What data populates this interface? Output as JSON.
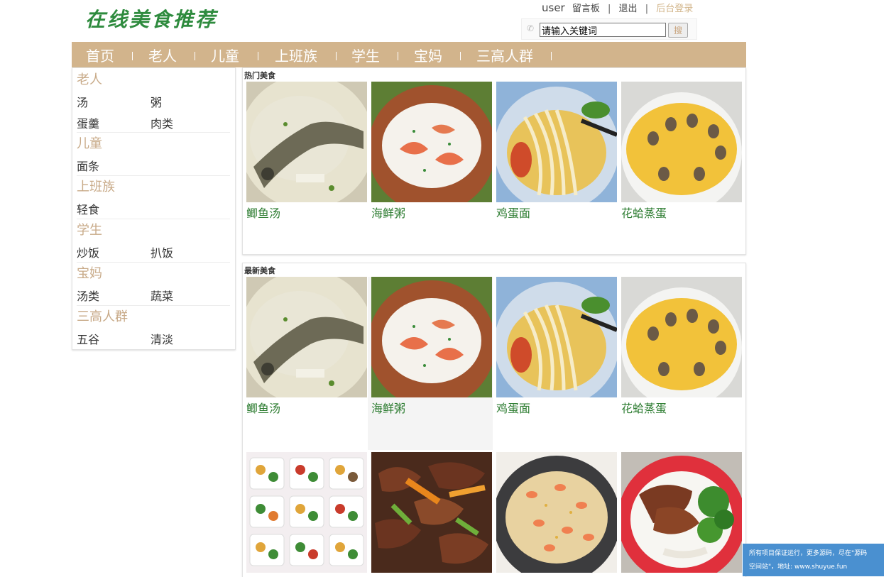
{
  "site_title": "在线美食推荐",
  "top": {
    "user": "user",
    "board": "留言板",
    "sep": "|",
    "logout": "退出",
    "admin": "后台登录"
  },
  "search": {
    "value": "请输入关键词",
    "button": "搜"
  },
  "nav": [
    "首页",
    "老人",
    "儿童",
    "上班族",
    "学生",
    "宝妈",
    "三高人群"
  ],
  "nav_sep": "|",
  "sidebar": [
    {
      "title": "老人",
      "rows": [
        [
          "汤",
          "粥"
        ],
        [
          "蛋羹",
          "肉类"
        ]
      ]
    },
    {
      "title": "儿童",
      "rows": [
        [
          "面条"
        ]
      ]
    },
    {
      "title": "上班族",
      "rows": [
        [
          "轻食"
        ]
      ]
    },
    {
      "title": "学生",
      "rows": [
        [
          "炒饭",
          "扒饭"
        ]
      ]
    },
    {
      "title": "宝妈",
      "rows": [
        [
          "汤类",
          "蔬菜"
        ]
      ]
    },
    {
      "title": "三高人群",
      "rows": [
        [
          "五谷",
          "清淡"
        ]
      ]
    }
  ],
  "hot": {
    "title": "热门美食",
    "items": [
      {
        "name": "鲫鱼汤",
        "icon": "fish-soup-photo"
      },
      {
        "name": "海鲜粥",
        "icon": "seafood-porridge-photo"
      },
      {
        "name": "鸡蛋面",
        "icon": "egg-noodles-photo"
      },
      {
        "name": "花蛤蒸蛋",
        "icon": "clam-steamed-egg-photo"
      }
    ]
  },
  "latest": {
    "title": "最新美食",
    "items": [
      {
        "name": "鲫鱼汤",
        "icon": "fish-soup-photo"
      },
      {
        "name": "海鲜粥",
        "icon": "seafood-porridge-photo"
      },
      {
        "name": "鸡蛋面",
        "icon": "egg-noodles-photo"
      },
      {
        "name": "花蛤蒸蛋",
        "icon": "clam-steamed-egg-photo"
      }
    ],
    "row2": [
      {
        "icon": "meal-prep-boxes-photo"
      },
      {
        "icon": "braised-beef-photo"
      },
      {
        "icon": "shrimp-fried-rice-photo"
      },
      {
        "icon": "chicken-rice-bowl-photo"
      }
    ]
  },
  "notice": {
    "line1": "所有项目保证运行，更多源码，尽在\"源码",
    "line2": "空间站\"，地址: www.shuyue.fun"
  },
  "colors": {
    "brand_green": "#2e8b3e",
    "nav_bg": "#d2b48c",
    "category_tan": "#c8aa88",
    "notice_bg": "#4a90d0"
  }
}
